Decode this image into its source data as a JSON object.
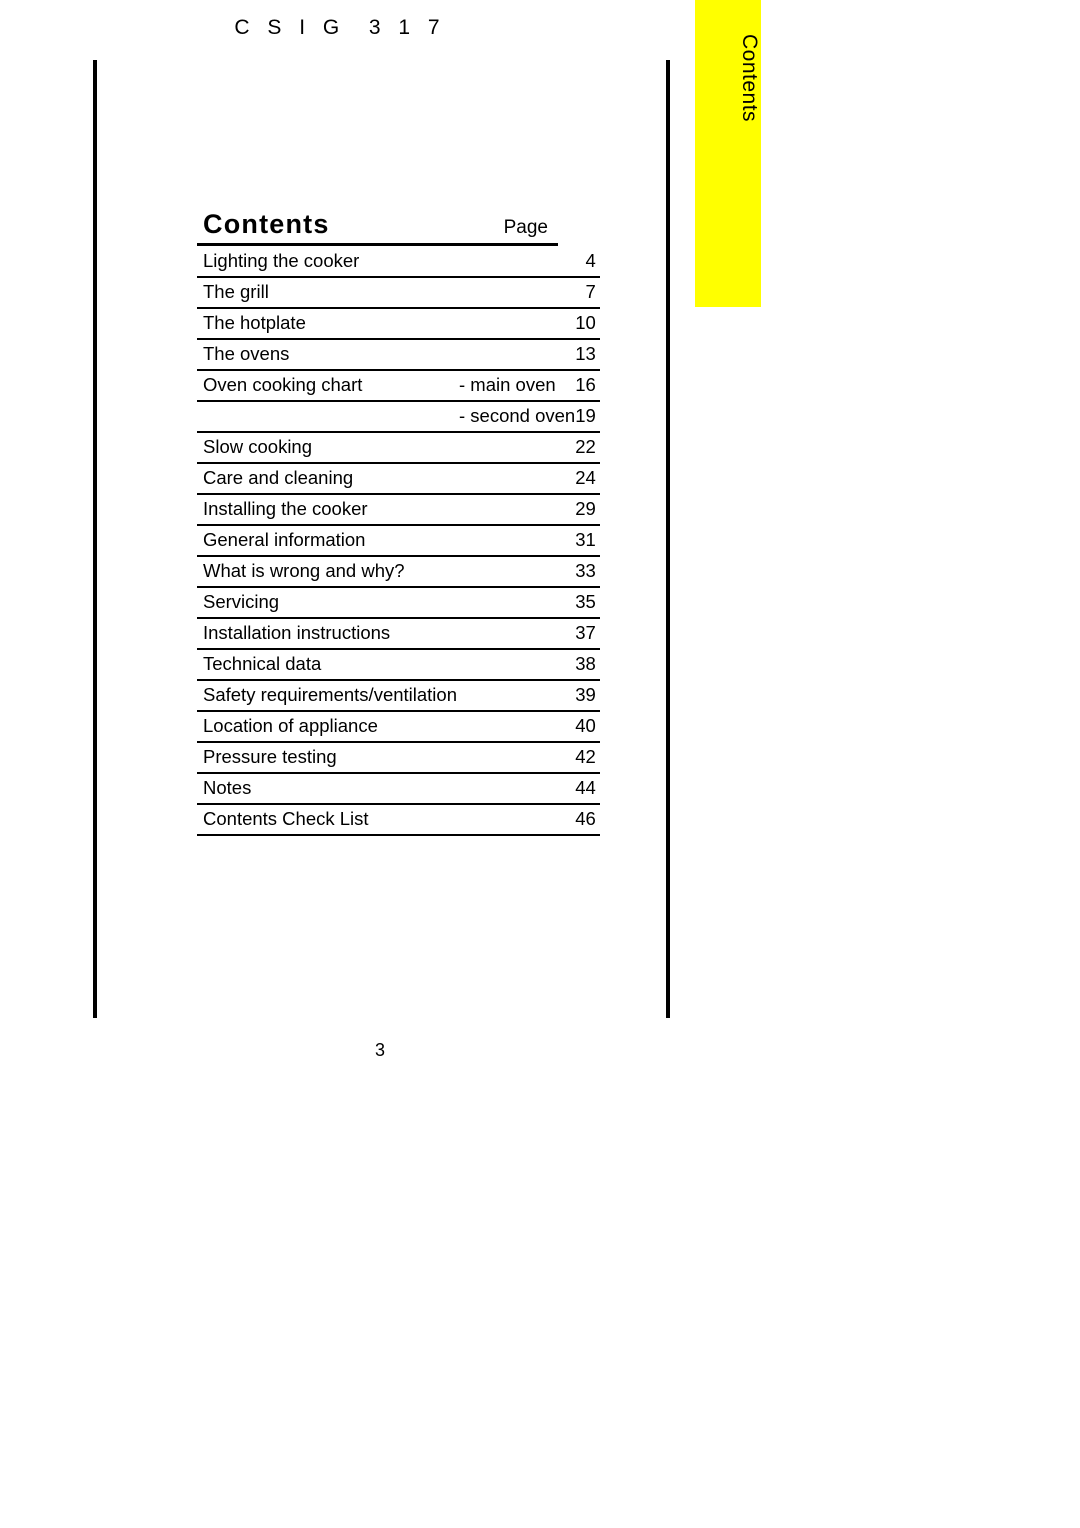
{
  "header": {
    "model_code": "C S I G  3 1 7"
  },
  "tab": {
    "label": "Contents",
    "color": "#FFFF00"
  },
  "toc": {
    "title": "Contents",
    "page_column_label": "Page",
    "rows": [
      {
        "title": "Lighting the cooker",
        "sub": "",
        "page": "4"
      },
      {
        "title": "The grill",
        "sub": "",
        "page": "7"
      },
      {
        "title": "The hotplate",
        "sub": "",
        "page": "10"
      },
      {
        "title": "The ovens",
        "sub": "",
        "page": "13"
      },
      {
        "title": "Oven cooking chart",
        "sub": "- main oven",
        "page": "16"
      },
      {
        "title": "",
        "sub": "- second oven",
        "page": "19"
      },
      {
        "title": "Slow cooking",
        "sub": "",
        "page": "22"
      },
      {
        "title": "Care and cleaning",
        "sub": "",
        "page": "24"
      },
      {
        "title": "Installing the cooker",
        "sub": "",
        "page": "29"
      },
      {
        "title": "General information",
        "sub": "",
        "page": "31"
      },
      {
        "title": "What is wrong and why?",
        "sub": "",
        "page": "33"
      },
      {
        "title": "Servicing",
        "sub": "",
        "page": "35"
      },
      {
        "title": "Installation instructions",
        "sub": "",
        "page": "37"
      },
      {
        "title": "Technical data",
        "sub": "",
        "page": "38"
      },
      {
        "title": "Safety requirements/ventilation",
        "sub": "",
        "page": "39"
      },
      {
        "title": "Location of appliance",
        "sub": "",
        "page": "40"
      },
      {
        "title": "Pressure testing",
        "sub": "",
        "page": "42"
      },
      {
        "title": "Notes",
        "sub": "",
        "page": "44"
      },
      {
        "title": "Contents Check List",
        "sub": "",
        "page": "46"
      }
    ]
  },
  "folio": {
    "page_number": "3"
  }
}
